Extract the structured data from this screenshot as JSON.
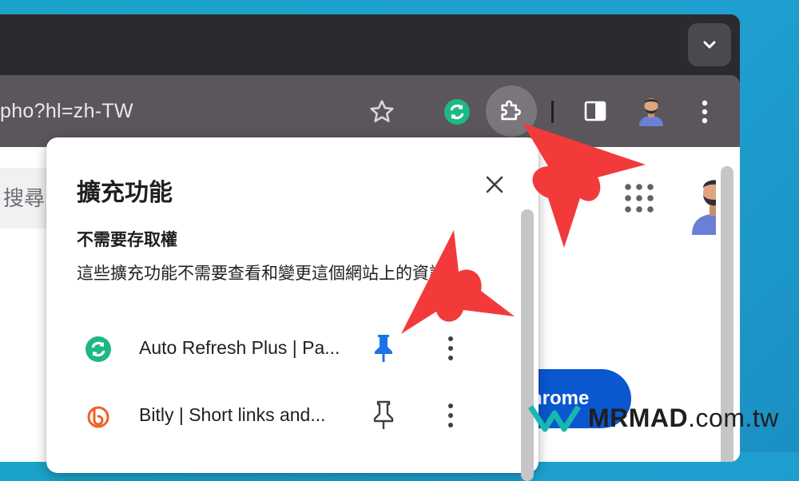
{
  "browser": {
    "url_fragment": "pho?hl=zh-TW",
    "icons": {
      "tab_search": "chevron-down-icon",
      "bookmark": "star-icon",
      "pinned_extension": "auto-refresh-icon",
      "extensions": "puzzle-icon",
      "side_panel": "side-panel-icon",
      "profile": "avatar-icon",
      "menu": "kebab-menu-icon"
    }
  },
  "page": {
    "search_placeholder": "搜尋",
    "button_label": "hrome",
    "colors": {
      "button": "#0b57d0"
    }
  },
  "extensions_popup": {
    "title": "擴充功能",
    "section_title": "不需要存取權",
    "section_description": "這些擴充功能不需要查看和變更這個網站上的資訊。",
    "items": [
      {
        "name": "Auto Refresh Plus | Pa...",
        "icon": "auto-refresh-icon",
        "pinned": true,
        "pin_color": "#1a73e8"
      },
      {
        "name": "Bitly | Short links and...",
        "icon": "bitly-icon",
        "pinned": false,
        "pin_color": "#3c4043"
      }
    ]
  },
  "annotations": {
    "arrow_color": "#f23a3a"
  },
  "watermark": {
    "brand": "MRMAD",
    "domain": ".com.tw"
  }
}
